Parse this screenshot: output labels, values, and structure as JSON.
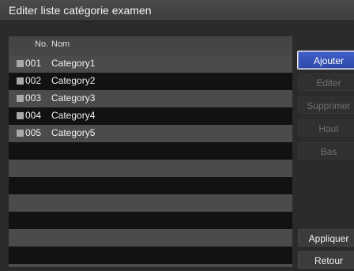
{
  "window": {
    "title": "Editer liste catégorie examen"
  },
  "table": {
    "columns": {
      "number": "No.",
      "name": "Nom"
    },
    "rows": [
      {
        "number": "001",
        "name": "Category1"
      },
      {
        "number": "002",
        "name": "Category2"
      },
      {
        "number": "003",
        "name": "Category3"
      },
      {
        "number": "004",
        "name": "Category4"
      },
      {
        "number": "005",
        "name": "Category5"
      }
    ]
  },
  "buttons": {
    "add": "Ajouter",
    "edit": "Editer",
    "delete": "Supprimer",
    "up": "Haut",
    "down": "Bas",
    "apply": "Appliquer",
    "back": "Retour"
  }
}
